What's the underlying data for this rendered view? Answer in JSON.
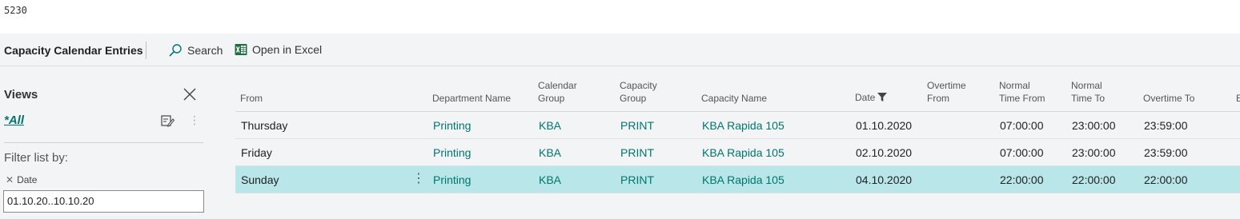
{
  "record_id": "5230",
  "header": {
    "title": "Capacity Calendar Entries",
    "actions": [
      {
        "label": "Search",
        "icon": "search-icon"
      },
      {
        "label": "Open in Excel",
        "icon": "excel-icon"
      }
    ]
  },
  "views": {
    "title": "Views",
    "current_view": "*All",
    "filter_label": "Filter list by:",
    "filter_field": "Date",
    "filter_value": "01.10.20..10.10.20"
  },
  "table": {
    "columns": [
      "From",
      "Department Name",
      "Calendar Group",
      "Capacity Group",
      "Capacity Name",
      "Date",
      "Overtime From",
      "Normal Time From",
      "Normal Time To",
      "Overtime To",
      "E"
    ],
    "column_lines": [
      [
        "From"
      ],
      [
        "Department Name"
      ],
      [
        "Calendar",
        "Group"
      ],
      [
        "Capacity",
        "Group"
      ],
      [
        "Capacity Name"
      ],
      [
        "Date"
      ],
      [
        "Overtime",
        "From"
      ],
      [
        "Normal",
        "Time From"
      ],
      [
        "Normal",
        "Time To"
      ],
      [
        "Overtime To"
      ],
      [
        "E"
      ]
    ],
    "rows": [
      {
        "from": "Thursday",
        "department": "Printing",
        "calendar_group": "KBA",
        "capacity_group": "PRINT",
        "capacity_name": "KBA Rapida 105",
        "date": "01.10.2020",
        "overtime_from": "",
        "normal_from": "07:00:00",
        "normal_to": "23:00:00",
        "overtime_to": "23:59:00",
        "selected": false
      },
      {
        "from": "Friday",
        "department": "Printing",
        "calendar_group": "KBA",
        "capacity_group": "PRINT",
        "capacity_name": "KBA Rapida 105",
        "date": "02.10.2020",
        "overtime_from": "",
        "normal_from": "07:00:00",
        "normal_to": "23:00:00",
        "overtime_to": "23:59:00",
        "selected": false
      },
      {
        "from": "Sunday",
        "department": "Printing",
        "calendar_group": "KBA",
        "capacity_group": "PRINT",
        "capacity_name": "KBA Rapida 105",
        "date": "04.10.2020",
        "overtime_from": "",
        "normal_from": "22:00:00",
        "normal_to": "22:00:00",
        "overtime_to": "22:00:00",
        "selected": true
      }
    ]
  },
  "colors": {
    "accent": "#00766f",
    "selected_row": "#b8e6e9",
    "excel_green": "#1d6f42",
    "page_background": "#f3f4f5"
  }
}
